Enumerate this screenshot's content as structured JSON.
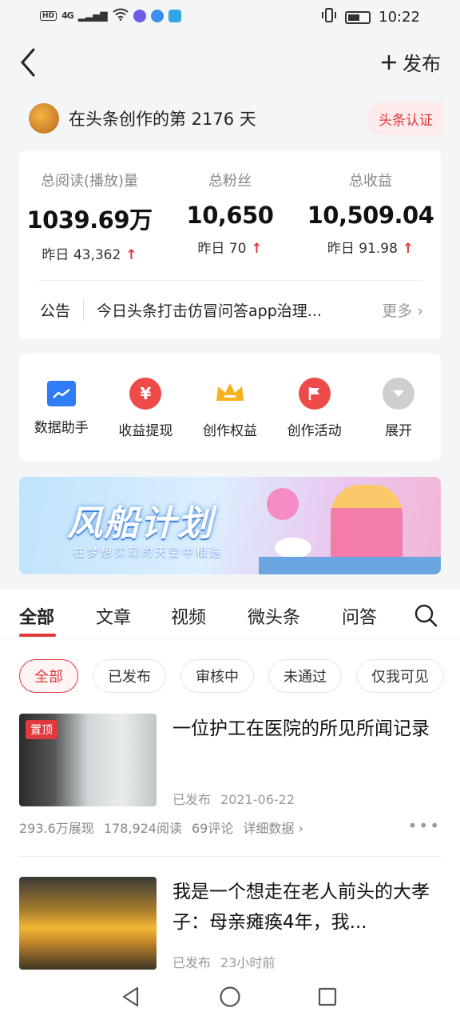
{
  "status_bar": {
    "hd": "HD",
    "network": "4G",
    "time": "10:22"
  },
  "header": {
    "publish_label": "发布"
  },
  "creator": {
    "text": "在头条创作的第 2176 天",
    "badge": "头条认证"
  },
  "stats": [
    {
      "label": "总阅读(播放)量",
      "value": "1039.69万",
      "yesterday": "昨日 43,362"
    },
    {
      "label": "总粉丝",
      "value": "10,650",
      "yesterday": "昨日 70"
    },
    {
      "label": "总收益",
      "value": "10,509.04",
      "yesterday": "昨日 91.98"
    }
  ],
  "notice": {
    "tag": "公告",
    "text": "今日头条打击仿冒问答app治理...",
    "more": "更多"
  },
  "tools": [
    {
      "label": "数据助手",
      "icon": "chart-icon",
      "color": "#2f7cf6"
    },
    {
      "label": "收益提现",
      "icon": "yuan-icon",
      "color": "#ef4a4a"
    },
    {
      "label": "创作权益",
      "icon": "crown-icon",
      "color": "#f6b21c"
    },
    {
      "label": "创作活动",
      "icon": "flag-icon",
      "color": "#ef4a4a"
    },
    {
      "label": "展开",
      "icon": "expand-icon",
      "color": "#cfcfcf"
    }
  ],
  "banner": {
    "title": "风船计划",
    "subtitle": "在梦想实现的天空中相遇"
  },
  "tabs": [
    "全部",
    "文章",
    "视频",
    "微头条",
    "问答"
  ],
  "filters": [
    "全部",
    "已发布",
    "审核中",
    "未通过",
    "仅我可见"
  ],
  "articles": [
    {
      "pin": "置顶",
      "title": "一位护工在医院的所见所闻记录",
      "status": "已发布",
      "date": "2021-06-22",
      "impressions": "293.6万展现",
      "reads": "178,924阅读",
      "comments": "69评论",
      "detail": "详细数据 ›"
    },
    {
      "title": "我是一个想走在老人前头的大孝子：母亲瘫痪4年，我...",
      "status": "已发布",
      "date": "23小时前"
    }
  ],
  "colors": {
    "accent": "#e0393e",
    "background": "#f4f5f6"
  }
}
